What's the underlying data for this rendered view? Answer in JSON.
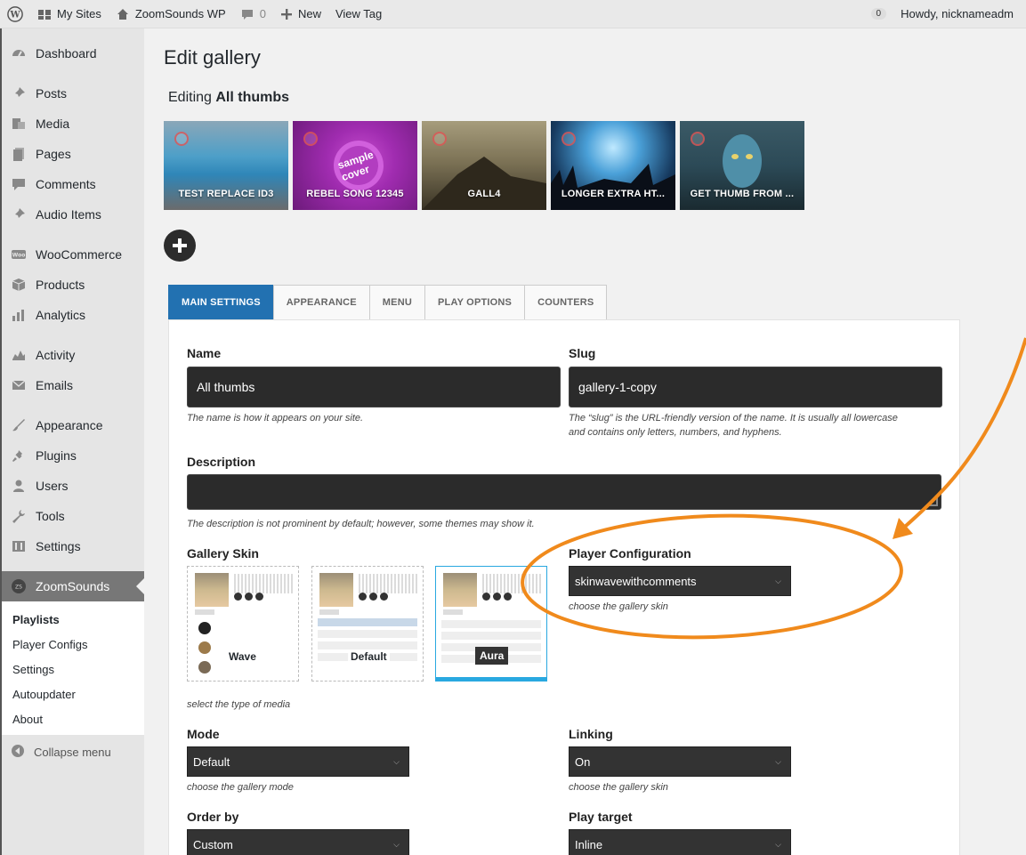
{
  "adminbar": {
    "my_sites": "My Sites",
    "site_name": "ZoomSounds WP",
    "comments_count": "0",
    "new_label": "New",
    "view_tag": "View Tag",
    "notif_count": "0",
    "howdy": "Howdy, nicknameadm"
  },
  "sidebar": {
    "items": [
      {
        "label": "Dashboard",
        "icon": "dashboard-icon"
      },
      {
        "label": "Posts",
        "icon": "pin-icon"
      },
      {
        "label": "Media",
        "icon": "media-icon"
      },
      {
        "label": "Pages",
        "icon": "pages-icon"
      },
      {
        "label": "Comments",
        "icon": "comment-icon"
      },
      {
        "label": "Audio Items",
        "icon": "pin-icon"
      },
      {
        "label": "WooCommerce",
        "icon": "woo-icon"
      },
      {
        "label": "Products",
        "icon": "box-icon"
      },
      {
        "label": "Analytics",
        "icon": "bar-chart-icon"
      },
      {
        "label": "Activity",
        "icon": "activity-icon"
      },
      {
        "label": "Emails",
        "icon": "mail-icon"
      },
      {
        "label": "Appearance",
        "icon": "brush-icon"
      },
      {
        "label": "Plugins",
        "icon": "plug-icon"
      },
      {
        "label": "Users",
        "icon": "user-icon"
      },
      {
        "label": "Tools",
        "icon": "wrench-icon"
      },
      {
        "label": "Settings",
        "icon": "settings-icon"
      },
      {
        "label": "ZoomSounds",
        "icon": "zoomsounds-icon"
      }
    ],
    "submenu": [
      "Playlists",
      "Player Configs",
      "Settings",
      "Autoupdater",
      "About"
    ],
    "collapse": "Collapse menu"
  },
  "page": {
    "title": "Edit gallery",
    "editing_prefix": "Editing",
    "editing_name": "All thumbs"
  },
  "thumbs": [
    "TEST REPLACE ID3",
    "REBEL SONG 12345",
    "GALL4",
    "LONGER EXTRA HT...",
    "GET THUMB FROM ..."
  ],
  "thumb2_cover": "sample cover",
  "tabs": [
    "MAIN SETTINGS",
    "APPEARANCE",
    "MENU",
    "PLAY OPTIONS",
    "COUNTERS"
  ],
  "form": {
    "name_label": "Name",
    "name_value": "All thumbs",
    "name_help": "The name is how it appears on your site.",
    "slug_label": "Slug",
    "slug_value": "gallery-1-copy",
    "slug_help": "The “slug” is the URL-friendly version of the name. It is usually all lowercase and contains only letters, numbers, and hyphens.",
    "desc_label": "Description",
    "desc_help": "The description is not prominent by default; however, some themes may show it.",
    "skin_label": "Gallery Skin",
    "skins": [
      "Wave",
      "Default",
      "Aura"
    ],
    "skin_help": "select the type of media",
    "player_config_label": "Player Configuration",
    "player_config_value": "skinwavewithcomments",
    "player_config_help": "choose the gallery skin",
    "mode_label": "Mode",
    "mode_value": "Default",
    "mode_help": "choose the gallery mode",
    "linking_label": "Linking",
    "linking_value": "On",
    "linking_help": "choose the gallery skin",
    "order_label": "Order by",
    "order_value": "Custom",
    "play_target_label": "Play target",
    "play_target_value": "Inline"
  },
  "colors": {
    "accent": "#2271b1",
    "annotation": "#f08a1c",
    "skin_selected": "#29a8e0"
  }
}
